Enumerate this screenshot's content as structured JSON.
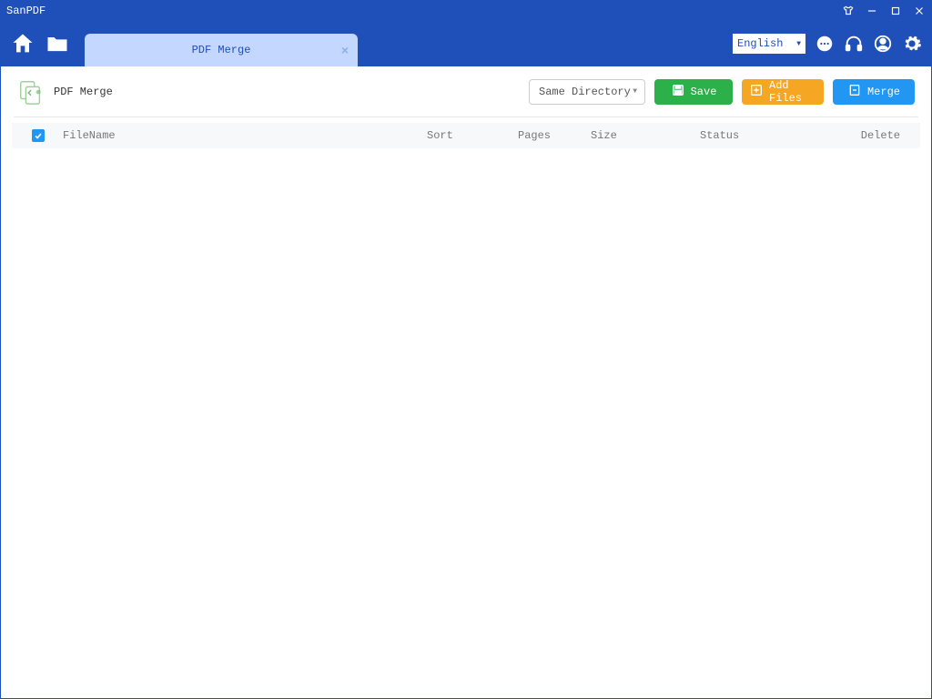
{
  "app": {
    "title": "SanPDF"
  },
  "header": {
    "tab_label": "PDF Merge",
    "language": "English"
  },
  "toolbar": {
    "title": "PDF Merge",
    "directory_option": "Same Directory",
    "save_label": "Save",
    "add_files_label": "Add Files",
    "merge_label": "Merge"
  },
  "table": {
    "columns": {
      "filename": "FileName",
      "sort": "Sort",
      "pages": "Pages",
      "size": "Size",
      "status": "Status",
      "delete": "Delete"
    }
  }
}
